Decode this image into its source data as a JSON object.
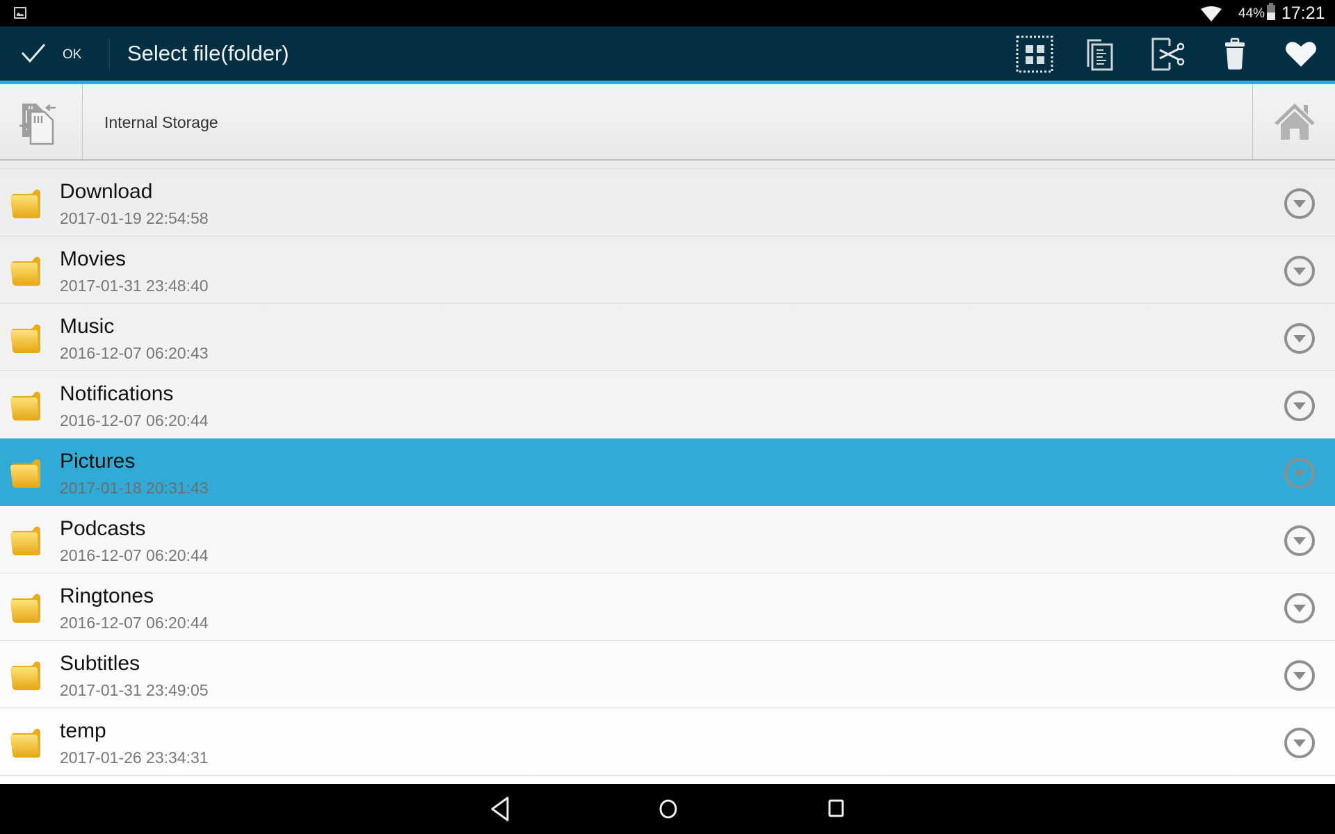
{
  "status_bar": {
    "battery_percent": "44%",
    "battery_level": 0.44,
    "time": "17:21",
    "icons": [
      "image-notification-icon",
      "wifi-icon",
      "battery-icon"
    ]
  },
  "toolbar": {
    "ok_label": "OK",
    "title": "Select file(folder)",
    "actions": [
      {
        "name": "select-all",
        "icon": "select-all-grid-icon"
      },
      {
        "name": "copy",
        "icon": "copy-icon"
      },
      {
        "name": "cut",
        "icon": "cut-icon"
      },
      {
        "name": "delete",
        "icon": "trash-icon"
      },
      {
        "name": "favorite",
        "icon": "heart-icon"
      }
    ]
  },
  "path_bar": {
    "storage_icon": "sd-card-switch-icon",
    "path": "Internal Storage",
    "home_icon": "home-icon"
  },
  "files": [
    {
      "name": "Download",
      "date": "2017-01-19 22:54:58",
      "selected": false
    },
    {
      "name": "Movies",
      "date": "2017-01-31 23:48:40",
      "selected": false
    },
    {
      "name": "Music",
      "date": "2016-12-07 06:20:43",
      "selected": false
    },
    {
      "name": "Notifications",
      "date": "2016-12-07 06:20:44",
      "selected": false
    },
    {
      "name": "Pictures",
      "date": "2017-01-18 20:31:43",
      "selected": true
    },
    {
      "name": "Podcasts",
      "date": "2016-12-07 06:20:44",
      "selected": false
    },
    {
      "name": "Ringtones",
      "date": "2016-12-07 06:20:44",
      "selected": false
    },
    {
      "name": "Subtitles",
      "date": "2017-01-31 23:49:05",
      "selected": false
    },
    {
      "name": "temp",
      "date": "2017-01-26 23:34:31",
      "selected": false
    }
  ],
  "nav_bar": {
    "buttons": [
      "back",
      "home",
      "recents"
    ]
  },
  "colors": {
    "toolbar_bg": "#032f42",
    "accent": "#2fabdb",
    "selected_row": "#31aad6",
    "folder": "#f2b822"
  }
}
